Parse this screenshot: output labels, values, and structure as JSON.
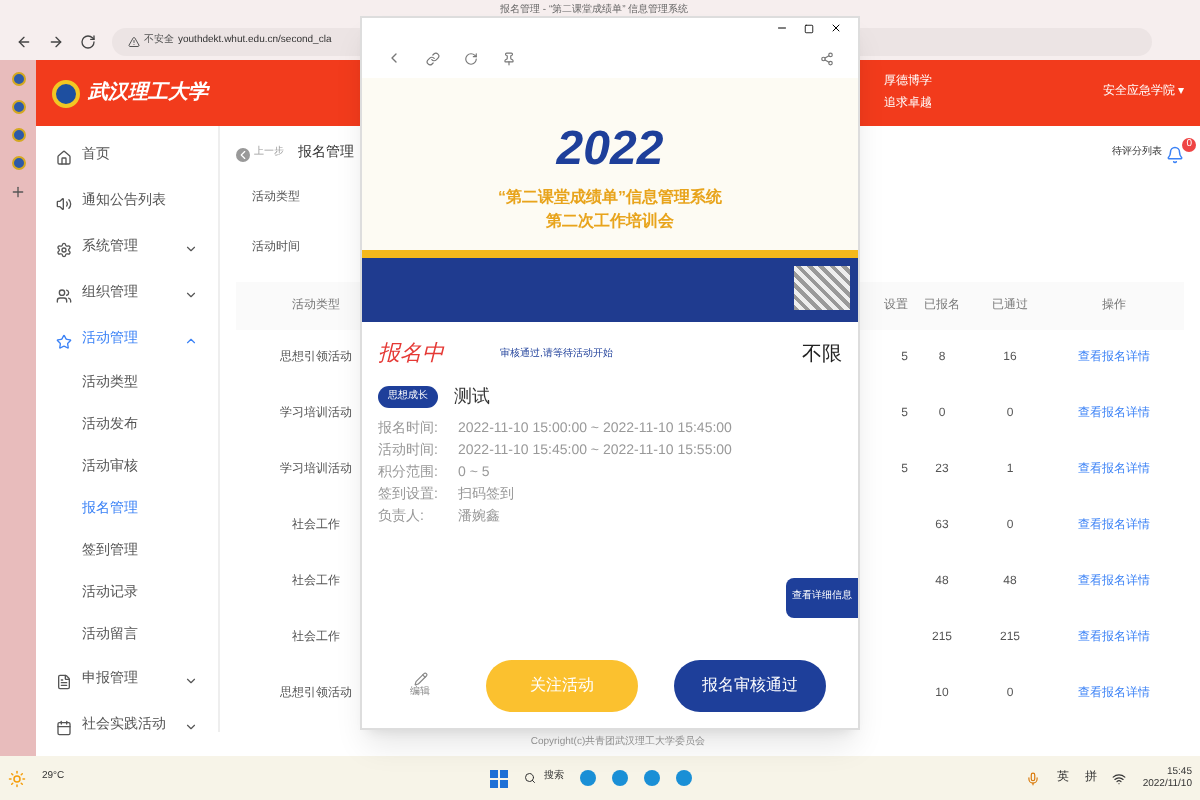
{
  "browser": {
    "tab_title": "报名管理 - “第二课堂成绩单” 信息管理系统",
    "security": "不安全",
    "url": "youthdekt.whut.edu.cn/second_cla"
  },
  "header": {
    "logo_text": "武汉理工大学",
    "motto": [
      "厚德博学",
      "追求卓越"
    ],
    "account": "安全应急学院 ▾"
  },
  "sidebar": {
    "items": [
      {
        "label": "首页",
        "kind": "home",
        "expanded": false,
        "has_children": false
      },
      {
        "label": "通知公告列表",
        "kind": "notice",
        "expanded": false,
        "has_children": false
      },
      {
        "label": "系统管理",
        "kind": "settings",
        "expanded": false,
        "has_children": true
      },
      {
        "label": "组织管理",
        "kind": "users",
        "expanded": false,
        "has_children": true
      },
      {
        "label": "活动管理",
        "kind": "star",
        "expanded": true,
        "has_children": true,
        "children": [
          {
            "label": "活动类型",
            "selected": false
          },
          {
            "label": "活动发布",
            "selected": false
          },
          {
            "label": "活动审核",
            "selected": false
          },
          {
            "label": "报名管理",
            "selected": true
          },
          {
            "label": "签到管理",
            "selected": false
          },
          {
            "label": "活动记录",
            "selected": false
          },
          {
            "label": "活动留言",
            "selected": false
          }
        ]
      },
      {
        "label": "申报管理",
        "kind": "file",
        "expanded": false,
        "has_children": true
      },
      {
        "label": "社会实践活动",
        "kind": "calendar",
        "expanded": false,
        "has_children": true
      }
    ]
  },
  "breadcrumb": {
    "back": "上一步",
    "current": "报名管理"
  },
  "notifications": {
    "label": "待评分列表",
    "count": "0"
  },
  "filters": [
    {
      "label": "活动类型"
    },
    {
      "label": "活动时间"
    }
  ],
  "table": {
    "columns": [
      "活动类型",
      "设置",
      "已报名",
      "已通过",
      "操作"
    ],
    "rows": [
      {
        "type": "思想引领活动",
        "column_2": "5",
        "registered": "8",
        "approved": "16",
        "action": "查看报名详情"
      },
      {
        "type": "学习培训活动",
        "column_2": "5",
        "registered": "0",
        "approved": "0",
        "action": "查看报名详情"
      },
      {
        "type": "学习培训活动",
        "column_2": "5",
        "registered": "23",
        "approved": "1",
        "action": "查看报名详情"
      },
      {
        "type": "社会工作",
        "registered": "63",
        "approved": "0",
        "action": "查看报名详情"
      },
      {
        "type": "社会工作",
        "registered": "48",
        "approved": "48",
        "action": "查看报名详情"
      },
      {
        "type": "社会工作",
        "registered": "215",
        "approved": "215",
        "action": "查看报名详情"
      },
      {
        "type": "思想引领活动",
        "registered": "10",
        "approved": "0",
        "action": "查看报名详情"
      }
    ]
  },
  "popup": {
    "banner_year": "2022",
    "banner_title": "“第二课堂成绩单”信息管理系统",
    "banner_subtitle": "第二次工作培训会",
    "status": "报名中",
    "notice": "审核通过,请等待活动开始",
    "quota": "不限",
    "tag": "思想成长",
    "name": "测试",
    "details": [
      {
        "label": "报名时间:",
        "value": "2022-11-10 15:00:00 ~ 2022-11-10 15:45:00"
      },
      {
        "label": "活动时间:",
        "value": "2022-11-10 15:45:00 ~ 2022-11-10 15:55:00"
      },
      {
        "label": "积分范围:",
        "value": "0 ~ 5"
      },
      {
        "label": "签到设置:",
        "value": "扫码签到"
      },
      {
        "label": "负责人:",
        "value": "潘婉鑫"
      }
    ],
    "detail_button": "查看详细信息",
    "edit_label": "编辑",
    "follow_button": "关注活动",
    "approve_button": "报名审核通过"
  },
  "copyright": "Copyright(c)共青团武汉理工大学委员会",
  "taskbar": {
    "temperature": "29°C",
    "search": "搜索",
    "ime": [
      "英",
      "拼"
    ],
    "time": "15:45",
    "date": "2022/11/10"
  }
}
